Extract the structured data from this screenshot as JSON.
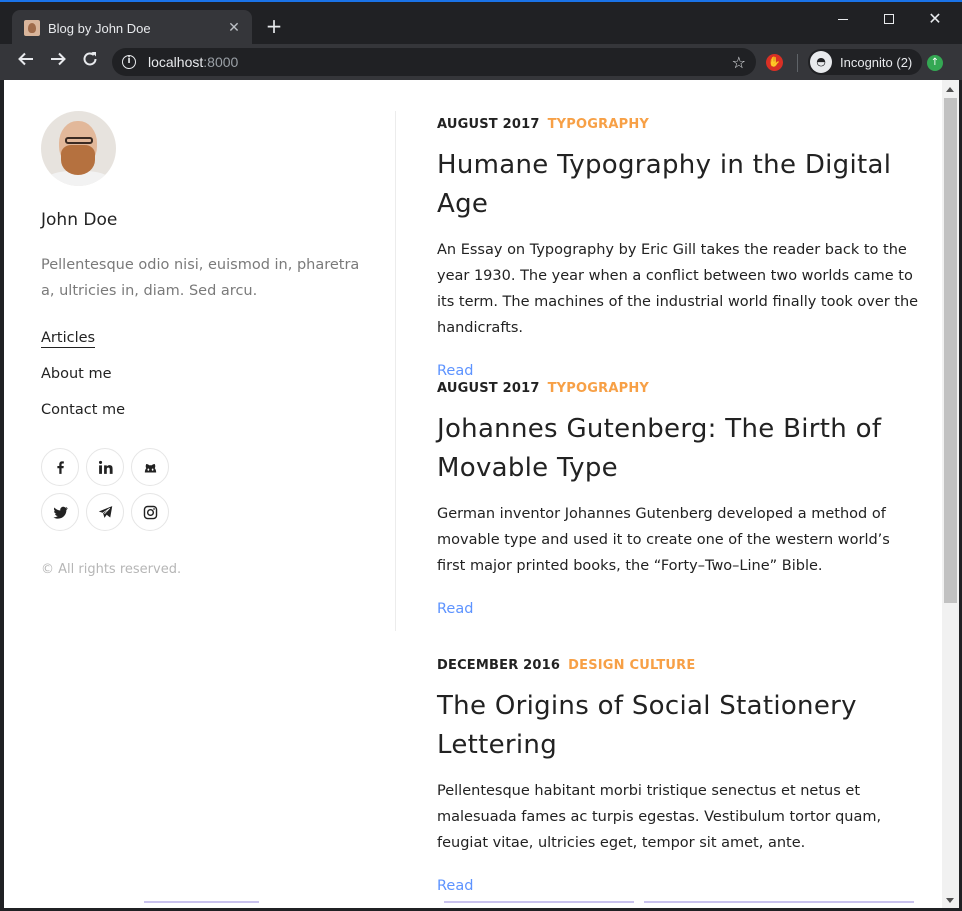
{
  "browser": {
    "tab_title": "Blog by John Doe",
    "tab_close": "✕",
    "new_tab": "+",
    "url_host": "localhost",
    "url_port": ":8000",
    "profile_label": "Incognito (2)",
    "accent_color": "#1a73e8"
  },
  "sidebar": {
    "author_name": "John Doe",
    "bio": "Pellentesque odio nisi, euismod in, pharetra a, ultricies in, diam. Sed arcu.",
    "menu": [
      {
        "label": "Articles",
        "active": true
      },
      {
        "label": "About me",
        "active": false
      },
      {
        "label": "Contact me",
        "active": false
      }
    ],
    "social_icons": [
      "facebook-icon",
      "linkedin-icon",
      "github-icon",
      "twitter-icon",
      "telegram-icon",
      "instagram-icon"
    ],
    "copyright": "© All rights reserved."
  },
  "posts": [
    {
      "date": "AUGUST 2017",
      "category": "TYPOGRAPHY",
      "title": "Humane Typography in the Digital Age",
      "excerpt": "An Essay on Typography by Eric Gill takes the reader back to the year 1930. The year when a conflict between two worlds came to its term. The machines of the industrial world finally took over the handicrafts.",
      "read_label": "Read"
    },
    {
      "date": "AUGUST 2017",
      "category": "TYPOGRAPHY",
      "title": "Johannes Gutenberg: The Birth of Movable Type",
      "excerpt": "German inventor Johannes Gutenberg developed a method of movable type and used it to create one of the western world’s first major printed books, the “Forty–Two–Line” Bible.",
      "read_label": "Read"
    },
    {
      "date": "DECEMBER 2016",
      "category": "DESIGN CULTURE",
      "title": "The Origins of Social Stationery Lettering",
      "excerpt": "Pellentesque habitant morbi tristique senectus et netus et malesuada fames ac turpis egestas. Vestibulum tortor quam, feugiat vitae, ultricies eget, tempor sit amet, ante.",
      "read_label": "Read"
    }
  ],
  "colors": {
    "category": "#f7a046",
    "link": "#5d93ff",
    "text": "#222222",
    "muted": "#7a7a7a"
  }
}
